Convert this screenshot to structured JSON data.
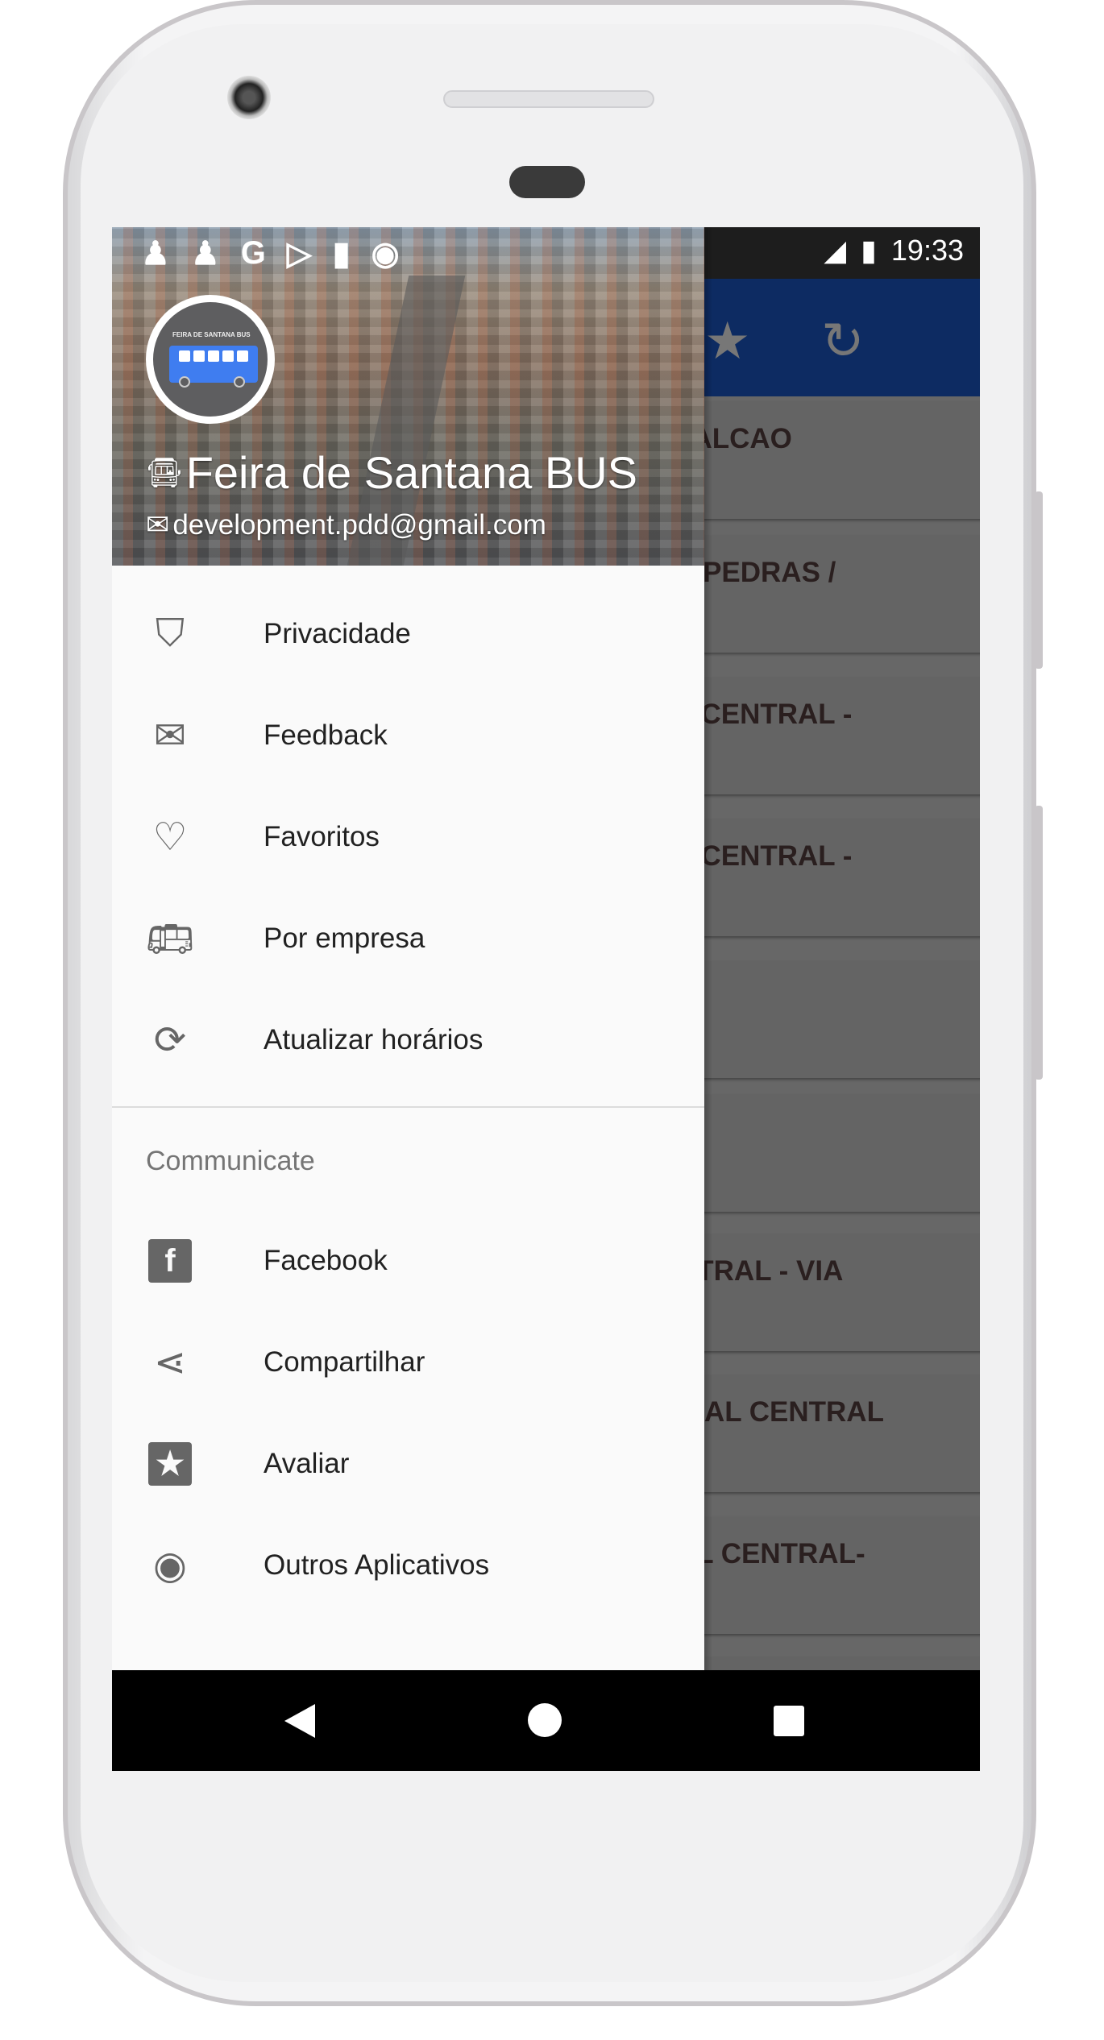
{
  "status_bar": {
    "time": "19:33"
  },
  "toolbar": {
    "favorite_icon": "star-icon",
    "refresh_icon": "refresh-icon"
  },
  "background_list": [
    "FALCAO",
    "S PEDRAS /",
    "L CENTRAL -",
    "L CENTRAL -",
    "",
    "",
    "NTRAL - VIA",
    "INAL CENTRAL",
    "AL CENTRAL-",
    ""
  ],
  "drawer": {
    "app_name": "Feira de Santana BUS",
    "email": "development.pdd@gmail.com",
    "logo_text": "FEIRA DE SANTANA BUS",
    "items": [
      {
        "label": "Privacidade",
        "icon": "shield-icon"
      },
      {
        "label": "Feedback",
        "icon": "mail-upload-icon"
      },
      {
        "label": "Favoritos",
        "icon": "heart-icon"
      },
      {
        "label": "Por empresa",
        "icon": "bus-icon"
      },
      {
        "label": "Atualizar horários",
        "icon": "sync-icon"
      }
    ],
    "section_title": "Communicate",
    "communicate_items": [
      {
        "label": "Facebook",
        "icon": "facebook-icon"
      },
      {
        "label": "Compartilhar",
        "icon": "share-icon"
      },
      {
        "label": "Avaliar",
        "icon": "star-box-icon"
      },
      {
        "label": "Outros Aplicativos",
        "icon": "eye-icon"
      }
    ]
  },
  "colors": {
    "toolbar": "#0d2b62",
    "drawer": "#fafafa",
    "bus_blue": "#3f7df0"
  }
}
